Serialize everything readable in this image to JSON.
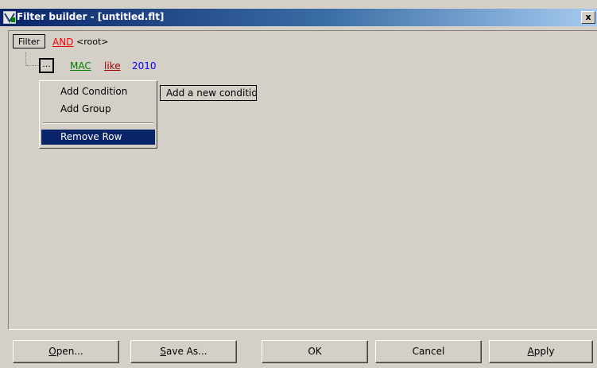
{
  "window": {
    "title": "Filter builder - [untitled.flt]",
    "close_glyph": "x"
  },
  "filter": {
    "button_label": "Filter",
    "operator": "AND",
    "root_label": "<root>"
  },
  "condition": {
    "menu_button_label": "...",
    "field": "MAC",
    "comparison": "like",
    "value": "2010"
  },
  "tooltip": {
    "text": "Add a new condition"
  },
  "context_menu": {
    "items": [
      {
        "label": "Add Condition"
      },
      {
        "label": "Add Group"
      },
      {
        "label": "Remove Row",
        "selected": true
      }
    ]
  },
  "buttons": {
    "open": {
      "accel": "O",
      "rest": "pen..."
    },
    "save_as": {
      "accel": "S",
      "rest": "ave As..."
    },
    "ok": {
      "label": "OK"
    },
    "cancel": {
      "label": "Cancel"
    },
    "apply": {
      "accel": "A",
      "rest": "pply"
    }
  },
  "colors": {
    "titlebar_start": "#0a246a",
    "titlebar_end": "#a6caf0",
    "operator": "#ff0000",
    "field": "#008000",
    "comparison": "#a00000",
    "value": "#0000ff",
    "selection": "#0a246a",
    "face": "#d4d0c8"
  }
}
